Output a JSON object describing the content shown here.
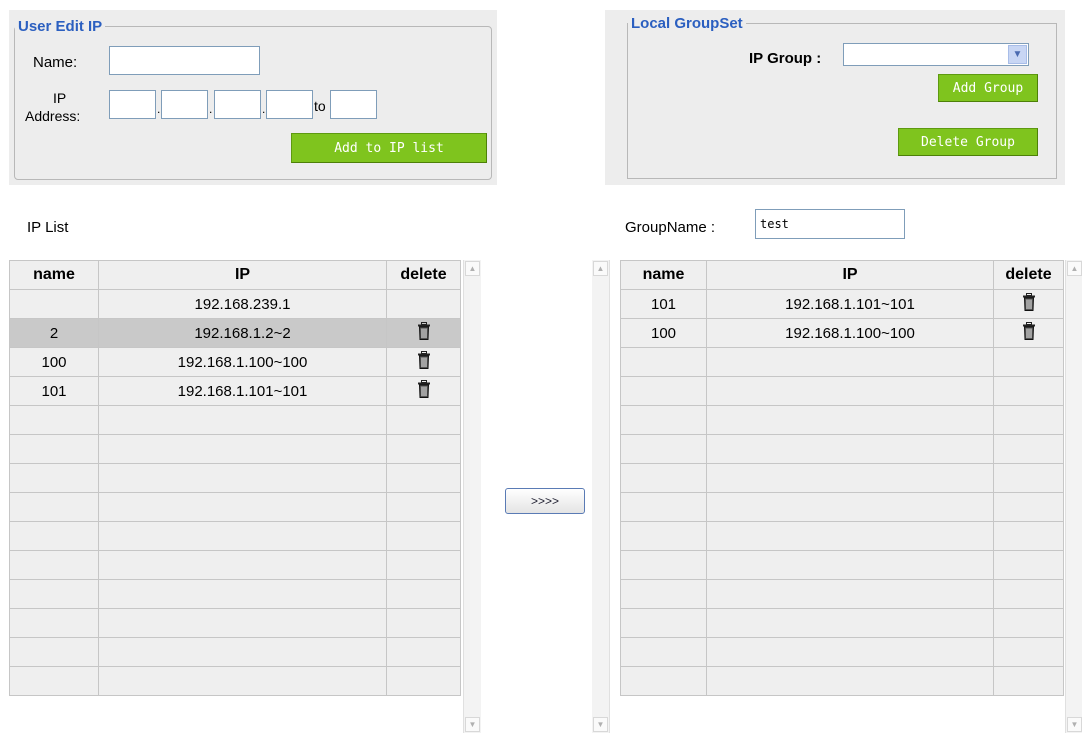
{
  "user_edit_ip": {
    "legend": "User Edit IP",
    "name_label": "Name:",
    "ip_label_1": "IP",
    "ip_label_2": "Address:",
    "dot": ".",
    "to_label": "to",
    "name_value": "",
    "ip_octets": [
      "",
      "",
      "",
      ""
    ],
    "ip_to_value": "",
    "add_button_label": "Add to IP list"
  },
  "local_group_set": {
    "legend": "Local GroupSet",
    "ip_group_label": "IP Group :",
    "ip_group_selected": "",
    "add_group_label": "Add Group",
    "delete_group_label": "Delete Group"
  },
  "ip_list": {
    "title": "IP List",
    "headers": {
      "name": "name",
      "ip": "IP",
      "delete": "delete"
    },
    "rows": [
      {
        "name": "",
        "ip": "192.168.239.1",
        "deletable": false,
        "selected": false
      },
      {
        "name": "2",
        "ip": "192.168.1.2~2",
        "deletable": true,
        "selected": true
      },
      {
        "name": "100",
        "ip": "192.168.1.100~100",
        "deletable": true,
        "selected": false
      },
      {
        "name": "101",
        "ip": "192.168.1.101~101",
        "deletable": true,
        "selected": false
      }
    ],
    "empty_rows": 10
  },
  "move_button_label": ">>>>",
  "group": {
    "group_name_label": "GroupName :",
    "group_name_value": "test",
    "headers": {
      "name": "name",
      "ip": "IP",
      "delete": "delete"
    },
    "rows": [
      {
        "name": "101",
        "ip": "192.168.1.101~101",
        "deletable": true
      },
      {
        "name": "100",
        "ip": "192.168.1.100~100",
        "deletable": true
      }
    ],
    "empty_rows": 12
  },
  "icons": {
    "delete": "trash-icon",
    "scroll_up": "chevron-up-icon",
    "scroll_down": "chevron-down-icon"
  },
  "colors": {
    "legend": "#2b5fc0",
    "green_button": "#7fc41e",
    "panel": "#ededed",
    "selected_row": "#c9c9c9"
  }
}
